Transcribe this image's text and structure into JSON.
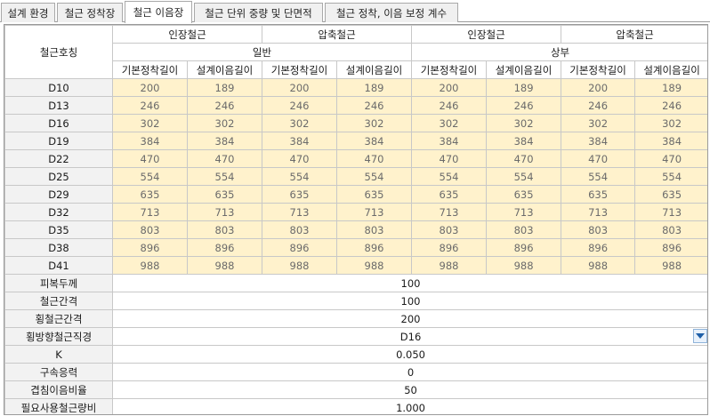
{
  "tabs": [
    {
      "label": "설계 환경",
      "active": false
    },
    {
      "label": "철근 정착장",
      "active": false
    },
    {
      "label": "철근 이음장",
      "active": true
    },
    {
      "label": "철근 단위 중량 및 단면적",
      "active": false
    },
    {
      "label": "철근 정착, 이음 보정 계수",
      "active": false
    }
  ],
  "grid": {
    "corner_label": "철근호칭",
    "group_row1": [
      "인장철근",
      "압축철근",
      "인장철근",
      "압축철근"
    ],
    "group_row2": [
      "일반",
      "상부"
    ],
    "subcols": [
      "기본정착길이",
      "설계이음길이",
      "기본정착길이",
      "설계이음길이",
      "기본정착길이",
      "설계이음길이",
      "기본정착길이",
      "설계이음길이"
    ],
    "rows": [
      {
        "name": "D10",
        "values": [
          "200",
          "189",
          "200",
          "189",
          "200",
          "189",
          "200",
          "189"
        ]
      },
      {
        "name": "D13",
        "values": [
          "246",
          "246",
          "246",
          "246",
          "246",
          "246",
          "246",
          "246"
        ]
      },
      {
        "name": "D16",
        "values": [
          "302",
          "302",
          "302",
          "302",
          "302",
          "302",
          "302",
          "302"
        ]
      },
      {
        "name": "D19",
        "values": [
          "384",
          "384",
          "384",
          "384",
          "384",
          "384",
          "384",
          "384"
        ]
      },
      {
        "name": "D22",
        "values": [
          "470",
          "470",
          "470",
          "470",
          "470",
          "470",
          "470",
          "470"
        ]
      },
      {
        "name": "D25",
        "values": [
          "554",
          "554",
          "554",
          "554",
          "554",
          "554",
          "554",
          "554"
        ]
      },
      {
        "name": "D29",
        "values": [
          "635",
          "635",
          "635",
          "635",
          "635",
          "635",
          "635",
          "635"
        ]
      },
      {
        "name": "D32",
        "values": [
          "713",
          "713",
          "713",
          "713",
          "713",
          "713",
          "713",
          "713"
        ]
      },
      {
        "name": "D35",
        "values": [
          "803",
          "803",
          "803",
          "803",
          "803",
          "803",
          "803",
          "803"
        ]
      },
      {
        "name": "D38",
        "values": [
          "896",
          "896",
          "896",
          "896",
          "896",
          "896",
          "896",
          "896"
        ]
      },
      {
        "name": "D41",
        "values": [
          "988",
          "988",
          "988",
          "988",
          "988",
          "988",
          "988",
          "988"
        ]
      }
    ],
    "params": [
      {
        "label": "피복두께",
        "value": "100",
        "control": "text"
      },
      {
        "label": "철근간격",
        "value": "100",
        "control": "text"
      },
      {
        "label": "횡철근간격",
        "value": "200",
        "control": "text"
      },
      {
        "label": "횡방향철근직경",
        "value": "D16",
        "control": "dropdown"
      },
      {
        "label": "K",
        "value": "0.050",
        "control": "text"
      },
      {
        "label": "구속응력",
        "value": "0",
        "control": "text"
      },
      {
        "label": "겹침이음비율",
        "value": "50",
        "control": "text"
      },
      {
        "label": "필요사용철근량비",
        "value": "1.000",
        "control": "text"
      }
    ]
  },
  "colors": {
    "value_cell_bg": "#fff2cc",
    "row_header_bg": "#f2f2f2",
    "dropdown_arrow": "#1e5fa8"
  },
  "icons": {
    "dropdown": "chevron-down-icon"
  }
}
